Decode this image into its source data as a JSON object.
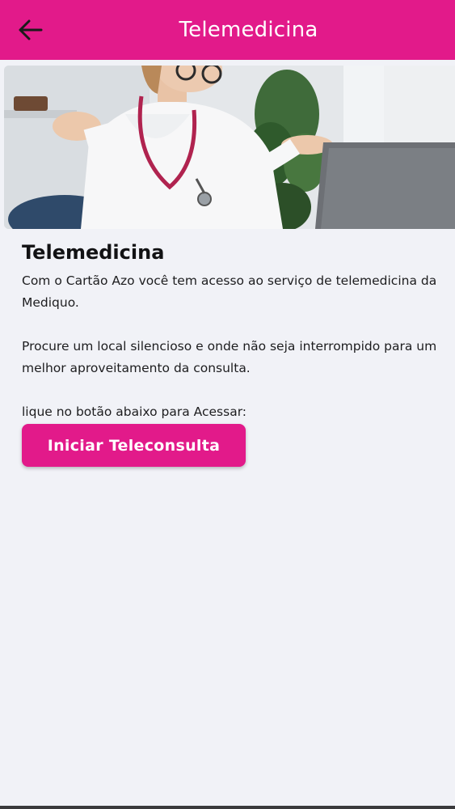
{
  "colors": {
    "accent": "#e21a8a",
    "background": "#f1f2f7",
    "text": "#1d1d1f"
  },
  "appbar": {
    "back_icon": "arrow-left-icon",
    "title": "Telemedicina"
  },
  "hero": {
    "image_description": "doctor-video-call-photo"
  },
  "content": {
    "heading": "Telemedicina",
    "paragraph_1": "Com o Cartão Azo você tem acesso ao serviço de telemedicina da Mediquo.",
    "paragraph_2": "Procure um local silencioso e onde não seja interrompido para um melhor aproveitamento da consulta.",
    "instruction": "lique no botão abaixo para Acessar:"
  },
  "cta": {
    "label": "Iniciar Teleconsulta"
  }
}
